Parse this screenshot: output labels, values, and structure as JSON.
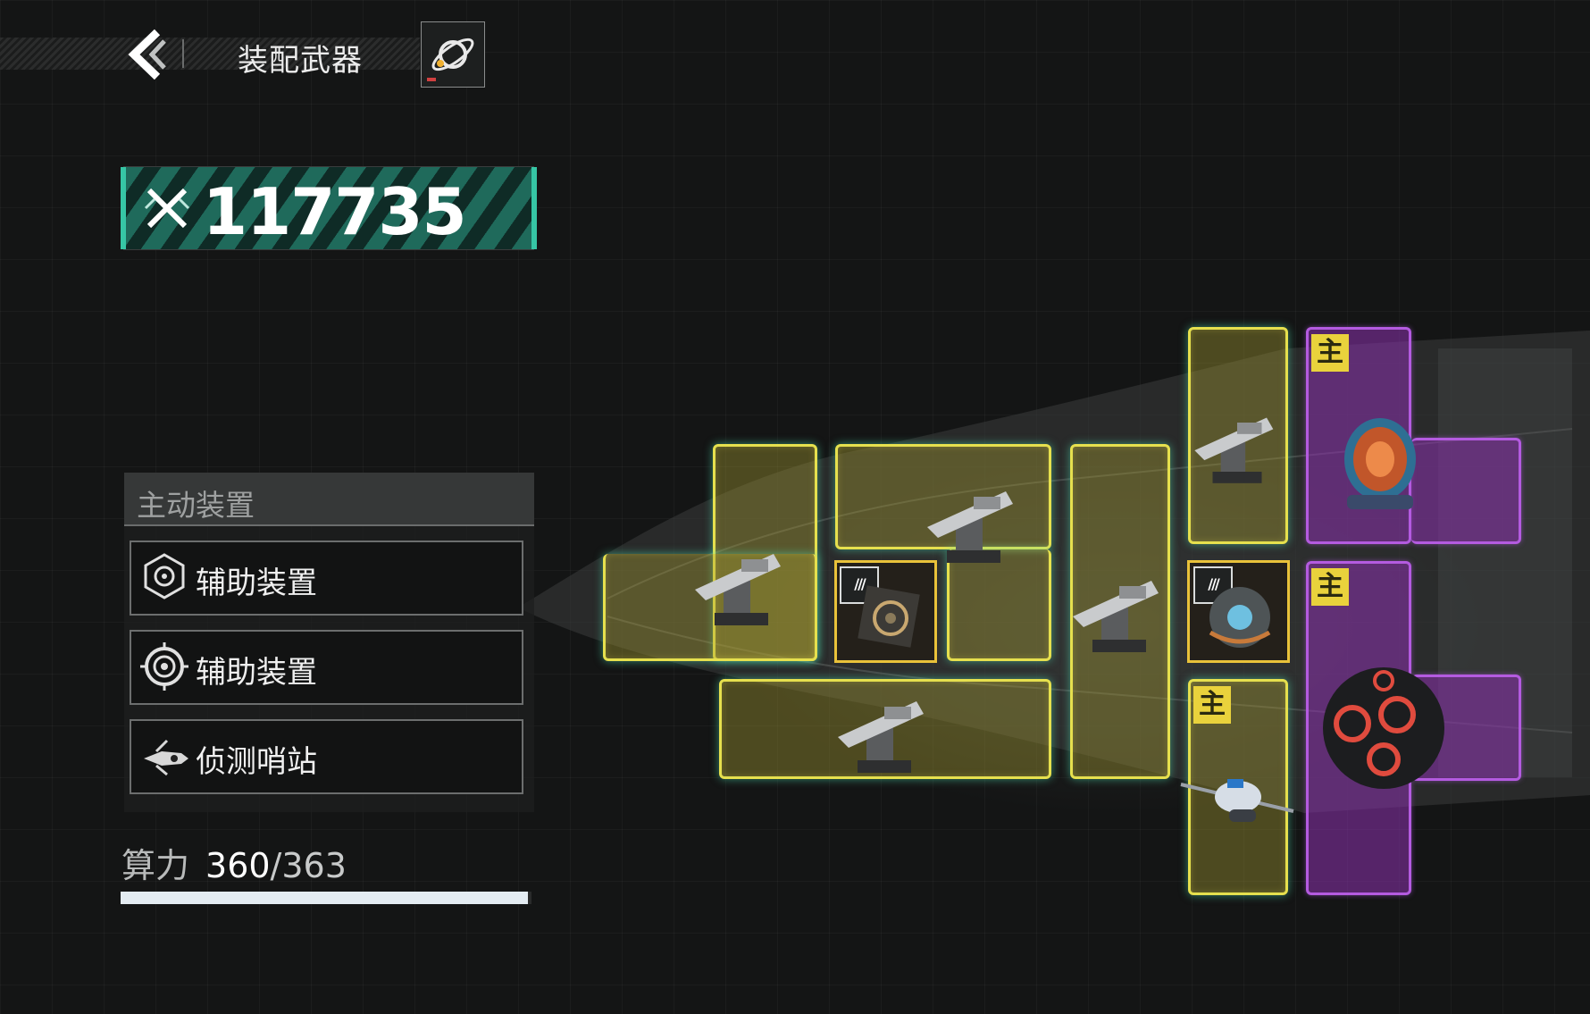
{
  "header": {
    "title": "装配武器",
    "back_icon": "back-chevron-icon",
    "planet_icon": "planet-orbit-icon"
  },
  "power": {
    "value": "117735",
    "icon": "crossed-swords-icon"
  },
  "menu": {
    "heading": "主动装置",
    "items": [
      {
        "label": "辅助装置",
        "icon": "radar-emblem-icon"
      },
      {
        "label": "辅助装置",
        "icon": "target-ring-icon"
      },
      {
        "label": "侦测哨站",
        "icon": "drone-ship-icon"
      }
    ]
  },
  "compute": {
    "label": "算力",
    "used": "360",
    "total": "/363",
    "fraction": 0.9917
  },
  "grid": {
    "main_badge": "主",
    "module_tag": "///",
    "colors": {
      "yellow": "#e6e04e",
      "purple": "#b45be0",
      "teal_glow": "#50e6b4",
      "accent": "#36c6a5"
    }
  }
}
